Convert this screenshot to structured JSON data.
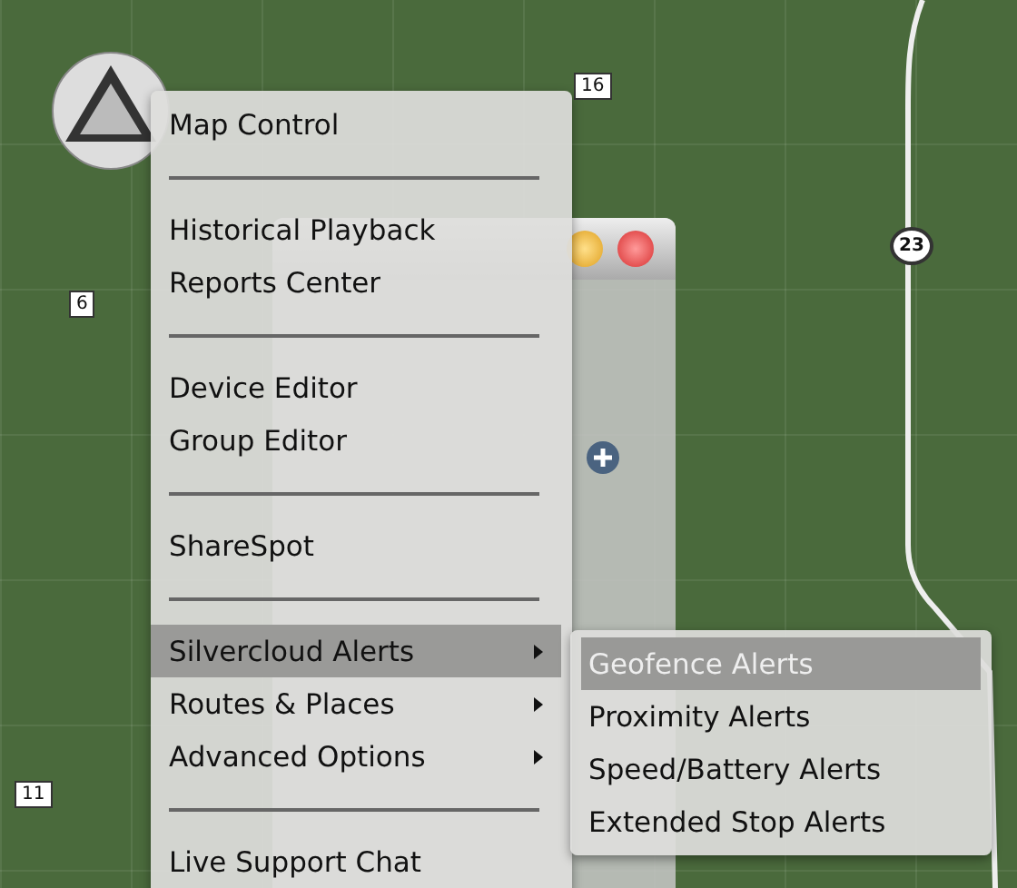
{
  "map": {
    "route_labels": [
      {
        "text": "16",
        "kind": "box"
      },
      {
        "text": "6",
        "kind": "box"
      },
      {
        "text": "23",
        "kind": "shield"
      },
      {
        "text": "11",
        "kind": "box"
      }
    ]
  },
  "menu": {
    "items": [
      {
        "kind": "item",
        "label": "Map Control",
        "selected": false
      },
      {
        "kind": "separator"
      },
      {
        "kind": "item",
        "label": "Historical Playback",
        "selected": false
      },
      {
        "kind": "item",
        "label": "Reports Center",
        "selected": false
      },
      {
        "kind": "separator"
      },
      {
        "kind": "item",
        "label": "Device Editor",
        "selected": false
      },
      {
        "kind": "item",
        "label": "Group Editor",
        "selected": false
      },
      {
        "kind": "separator"
      },
      {
        "kind": "item",
        "label": "ShareSpot",
        "selected": false
      },
      {
        "kind": "separator"
      },
      {
        "kind": "item",
        "label": "Silvercloud Alerts",
        "selected": true,
        "has_submenu": true,
        "submenu": [
          {
            "label": "Geofence Alerts",
            "selected": true
          },
          {
            "label": "Proximity Alerts",
            "selected": false
          },
          {
            "label": "Speed/Battery Alerts",
            "selected": false
          },
          {
            "label": "Extended Stop Alerts",
            "selected": false
          }
        ]
      },
      {
        "kind": "item",
        "label": "Routes & Places",
        "selected": false,
        "has_submenu": true
      },
      {
        "kind": "item",
        "label": "Advanced Options",
        "selected": false,
        "has_submenu": true
      },
      {
        "kind": "separator"
      },
      {
        "kind": "item",
        "label": "Live Support Chat",
        "selected": false
      }
    ]
  }
}
